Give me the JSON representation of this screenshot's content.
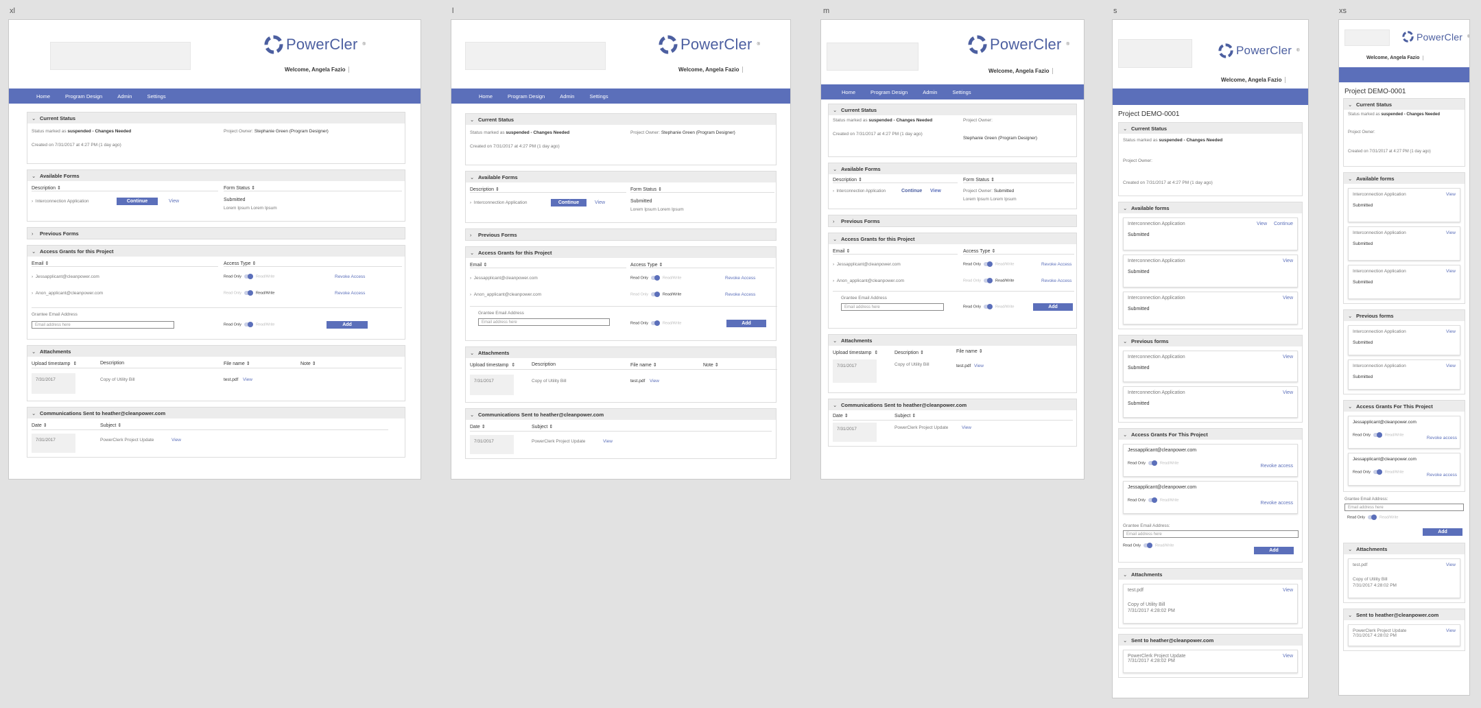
{
  "labels": {
    "xl": "xl",
    "l": "l",
    "m": "m",
    "s": "s",
    "xs": "xs"
  },
  "brand": {
    "name": "PowerCler",
    "mark": "®",
    "color": "#4c5fa0",
    "nav_color": "#5b6fba"
  },
  "welcome": "Welcome, Angela Fazio",
  "nav": [
    "Home",
    "Program Design",
    "Admin",
    "Settings"
  ],
  "project_id": "Project DEMO-0001",
  "current_status": {
    "title": "Current Status",
    "prefix": "Status marked as",
    "status": "suspended - Changes Needed",
    "created": "Created on 7/31/2017 at 4:27 PM (1 day ago)",
    "owner_label": "Project Owner:",
    "owner": "Stephanie Green (Program Designer)"
  },
  "available_forms": {
    "title": "Available Forms",
    "title_small": "Available forms",
    "col_description": "Description",
    "col_status": "Form Status",
    "form": "Interconnection Application",
    "continue": "Continue",
    "view": "View",
    "status": "Submitted",
    "note": "Lorem Ipsum Lorem Ipsum"
  },
  "previous_forms": {
    "title": "Previous Forms",
    "title_small": "Previous forms"
  },
  "access": {
    "title": "Access Grants for this Project",
    "title_small": "Access Grants For This Project",
    "col_email": "Email",
    "col_type": "Access Type",
    "read_only": "Read Only",
    "read_write": "Read/Write",
    "revoke": "Revoke Access",
    "revoke_small": "Revoke access",
    "emails": [
      "Jessapplicant@cleanpower.com",
      "Anon_applicant@cleanpower.com"
    ],
    "grantee_label": "Grantee Email Address",
    "grantee_label_small": "Grantee Email Address:",
    "placeholder": "Email address here",
    "add": "Add"
  },
  "attachments": {
    "title": "Attachments",
    "col_upload": "Upload timestamp",
    "col_desc": "Description",
    "col_file": "File name",
    "col_note": "Note",
    "date": "7/31/2017",
    "desc": "Copy of Utility Bill",
    "file": "test.pdf",
    "view": "View",
    "stamp": "7/31/2017 4:28:02 PM"
  },
  "comms": {
    "title": "Communications Sent to heather@cleanpower.com",
    "title_small": "Sent to heather@cleanpower.com",
    "col_date": "Date",
    "col_subject": "Subject",
    "date": "7/31/2017",
    "subject": "PowerClerk Project Update",
    "view": "View"
  },
  "icons": [
    "logo-icon",
    "chevron-down-icon",
    "chevron-right-icon",
    "sort-icon",
    "toggle-icon"
  ]
}
